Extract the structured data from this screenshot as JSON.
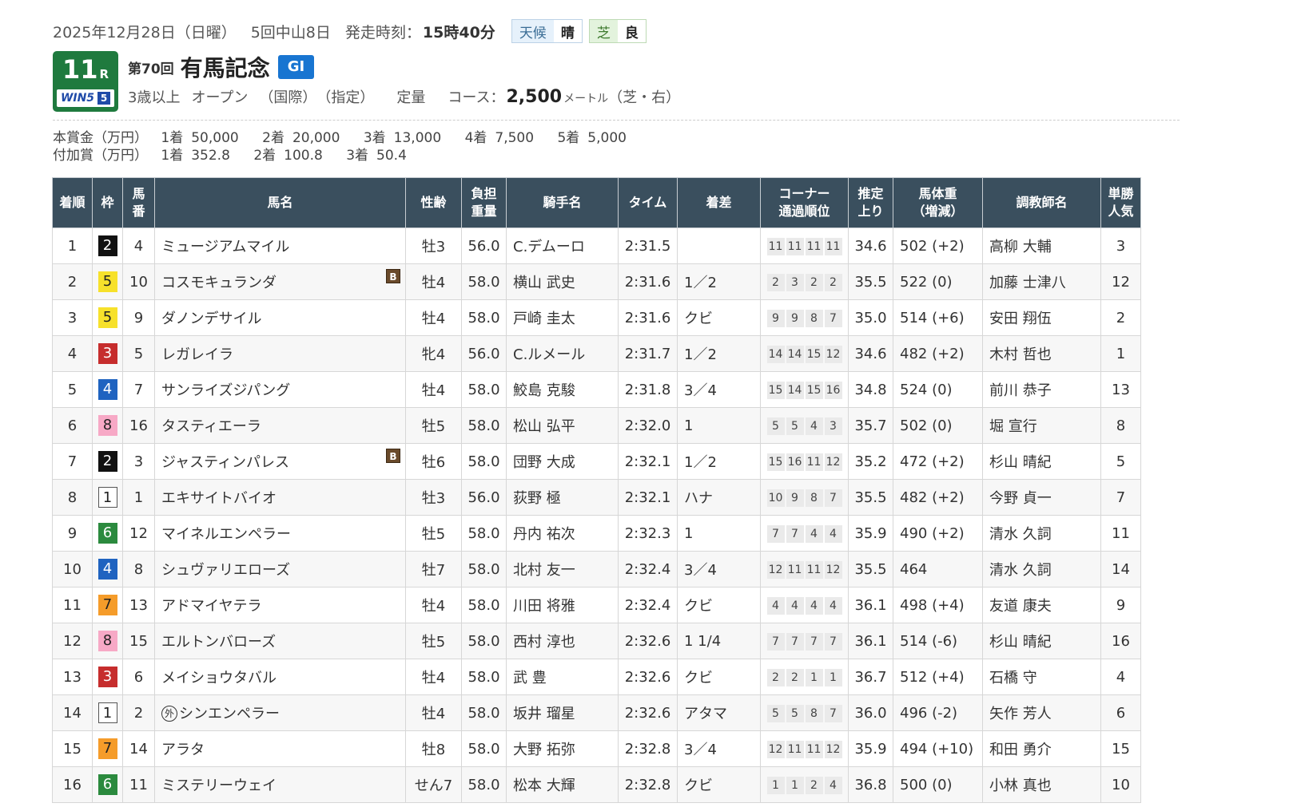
{
  "header": {
    "date_line": "2025年12月28日（日曜）",
    "meeting": "5回中山8日",
    "post_label": "発走時刻：",
    "post_time": "15時40分",
    "weather_label": "天候",
    "weather": "晴",
    "turf_label": "芝",
    "going": "良"
  },
  "race": {
    "number": "11",
    "number_suffix": "R",
    "win5_label": "WIN5",
    "win5_number": "5",
    "kai": "第70回",
    "name": "有馬記念",
    "grade": "GI",
    "age": "3歳以上",
    "class": "オープン",
    "intl": "（国際）",
    "designated": "（指定）",
    "weight_rule": "定量",
    "course_label": "コース：",
    "distance": "2,500",
    "distance_unit": "メートル",
    "surface": "（芝・右）"
  },
  "prize": {
    "main_title": "本賞金（万円）",
    "main": [
      {
        "place": "1着",
        "amount": "50,000"
      },
      {
        "place": "2着",
        "amount": "20,000"
      },
      {
        "place": "3着",
        "amount": "13,000"
      },
      {
        "place": "4着",
        "amount": "7,500"
      },
      {
        "place": "5着",
        "amount": "5,000"
      }
    ],
    "add_title": "付加賞（万円）",
    "add": [
      {
        "place": "1着",
        "amount": "352.8"
      },
      {
        "place": "2着",
        "amount": "100.8"
      },
      {
        "place": "3着",
        "amount": "50.4"
      }
    ]
  },
  "columns": {
    "place": "着順",
    "waku": "枠",
    "umaban_1": "馬",
    "umaban_2": "番",
    "horse": "馬名",
    "sexage": "性齢",
    "weight_1": "負担",
    "weight_2": "重量",
    "jockey": "騎手名",
    "time": "タイム",
    "margin": "着差",
    "corner_1": "コーナー",
    "corner_2": "通過順位",
    "last3f_1": "推定",
    "last3f_2": "上り",
    "bw_1": "馬体重",
    "bw_2": "（増減）",
    "trainer": "調教師名",
    "pop_1": "単勝",
    "pop_2": "人気"
  },
  "rows": [
    {
      "place": "1",
      "waku": "2",
      "umaban": "4",
      "horse": "ミュージアムマイル",
      "blinker": "",
      "gai": "",
      "sexage": "牡3",
      "weight": "56.0",
      "jockey": "C.デムーロ",
      "time": "2:31.5",
      "margin": "",
      "corners": [
        "11",
        "11",
        "11",
        "11"
      ],
      "last3f": "34.6",
      "bw": "502 (+2)",
      "trainer": "高柳 大輔",
      "pop": "3"
    },
    {
      "place": "2",
      "waku": "5",
      "umaban": "10",
      "horse": "コスモキュランダ",
      "blinker": "B",
      "gai": "",
      "sexage": "牡4",
      "weight": "58.0",
      "jockey": "横山 武史",
      "time": "2:31.6",
      "margin": "1／2",
      "corners": [
        "2",
        "3",
        "2",
        "2"
      ],
      "last3f": "35.5",
      "bw": "522 (0)",
      "trainer": "加藤 士津八",
      "pop": "12"
    },
    {
      "place": "3",
      "waku": "5",
      "umaban": "9",
      "horse": "ダノンデサイル",
      "blinker": "",
      "gai": "",
      "sexage": "牡4",
      "weight": "58.0",
      "jockey": "戸崎 圭太",
      "time": "2:31.6",
      "margin": "クビ",
      "corners": [
        "9",
        "9",
        "8",
        "7"
      ],
      "last3f": "35.0",
      "bw": "514 (+6)",
      "trainer": "安田 翔伍",
      "pop": "2"
    },
    {
      "place": "4",
      "waku": "3",
      "umaban": "5",
      "horse": "レガレイラ",
      "blinker": "",
      "gai": "",
      "sexage": "牝4",
      "weight": "56.0",
      "jockey": "C.ルメール",
      "time": "2:31.7",
      "margin": "1／2",
      "corners": [
        "14",
        "14",
        "15",
        "12"
      ],
      "last3f": "34.6",
      "bw": "482 (+2)",
      "trainer": "木村 哲也",
      "pop": "1"
    },
    {
      "place": "5",
      "waku": "4",
      "umaban": "7",
      "horse": "サンライズジパング",
      "blinker": "",
      "gai": "",
      "sexage": "牡4",
      "weight": "58.0",
      "jockey": "鮫島 克駿",
      "time": "2:31.8",
      "margin": "3／4",
      "corners": [
        "15",
        "14",
        "15",
        "16"
      ],
      "last3f": "34.8",
      "bw": "524 (0)",
      "trainer": "前川 恭子",
      "pop": "13"
    },
    {
      "place": "6",
      "waku": "8",
      "umaban": "16",
      "horse": "タスティエーラ",
      "blinker": "",
      "gai": "",
      "sexage": "牡5",
      "weight": "58.0",
      "jockey": "松山 弘平",
      "time": "2:32.0",
      "margin": "1",
      "corners": [
        "5",
        "5",
        "4",
        "3"
      ],
      "last3f": "35.7",
      "bw": "502 (0)",
      "trainer": "堀 宣行",
      "pop": "8"
    },
    {
      "place": "7",
      "waku": "2",
      "umaban": "3",
      "horse": "ジャスティンパレス",
      "blinker": "B",
      "gai": "",
      "sexage": "牡6",
      "weight": "58.0",
      "jockey": "団野 大成",
      "time": "2:32.1",
      "margin": "1／2",
      "corners": [
        "15",
        "16",
        "11",
        "12"
      ],
      "last3f": "35.2",
      "bw": "472 (+2)",
      "trainer": "杉山 晴紀",
      "pop": "5"
    },
    {
      "place": "8",
      "waku": "1",
      "umaban": "1",
      "horse": "エキサイトバイオ",
      "blinker": "",
      "gai": "",
      "sexage": "牡3",
      "weight": "56.0",
      "jockey": "荻野 極",
      "time": "2:32.1",
      "margin": "ハナ",
      "corners": [
        "10",
        "9",
        "8",
        "7"
      ],
      "last3f": "35.5",
      "bw": "482 (+2)",
      "trainer": "今野 貞一",
      "pop": "7"
    },
    {
      "place": "9",
      "waku": "6",
      "umaban": "12",
      "horse": "マイネルエンペラー",
      "blinker": "",
      "gai": "",
      "sexage": "牡5",
      "weight": "58.0",
      "jockey": "丹内 祐次",
      "time": "2:32.3",
      "margin": "1",
      "corners": [
        "7",
        "7",
        "4",
        "4"
      ],
      "last3f": "35.9",
      "bw": "490 (+2)",
      "trainer": "清水 久詞",
      "pop": "11"
    },
    {
      "place": "10",
      "waku": "4",
      "umaban": "8",
      "horse": "シュヴァリエローズ",
      "blinker": "",
      "gai": "",
      "sexage": "牡7",
      "weight": "58.0",
      "jockey": "北村 友一",
      "time": "2:32.4",
      "margin": "3／4",
      "corners": [
        "12",
        "11",
        "11",
        "12"
      ],
      "last3f": "35.5",
      "bw": "464",
      "trainer": "清水 久詞",
      "pop": "14"
    },
    {
      "place": "11",
      "waku": "7",
      "umaban": "13",
      "horse": "アドマイヤテラ",
      "blinker": "",
      "gai": "",
      "sexage": "牡4",
      "weight": "58.0",
      "jockey": "川田 将雅",
      "time": "2:32.4",
      "margin": "クビ",
      "corners": [
        "4",
        "4",
        "4",
        "4"
      ],
      "last3f": "36.1",
      "bw": "498 (+4)",
      "trainer": "友道 康夫",
      "pop": "9"
    },
    {
      "place": "12",
      "waku": "8",
      "umaban": "15",
      "horse": "エルトンバローズ",
      "blinker": "",
      "gai": "",
      "sexage": "牡5",
      "weight": "58.0",
      "jockey": "西村 淳也",
      "time": "2:32.6",
      "margin": "1 1/4",
      "corners": [
        "7",
        "7",
        "7",
        "7"
      ],
      "last3f": "36.1",
      "bw": "514 (-6)",
      "trainer": "杉山 晴紀",
      "pop": "16"
    },
    {
      "place": "13",
      "waku": "3",
      "umaban": "6",
      "horse": "メイショウタバル",
      "blinker": "",
      "gai": "",
      "sexage": "牡4",
      "weight": "58.0",
      "jockey": "武 豊",
      "time": "2:32.6",
      "margin": "クビ",
      "corners": [
        "2",
        "2",
        "1",
        "1"
      ],
      "last3f": "36.7",
      "bw": "512 (+4)",
      "trainer": "石橋 守",
      "pop": "4"
    },
    {
      "place": "14",
      "waku": "1",
      "umaban": "2",
      "horse": "シンエンペラー",
      "blinker": "",
      "gai": "外",
      "sexage": "牡4",
      "weight": "58.0",
      "jockey": "坂井 瑠星",
      "time": "2:32.6",
      "margin": "アタマ",
      "corners": [
        "5",
        "5",
        "8",
        "7"
      ],
      "last3f": "36.0",
      "bw": "496 (-2)",
      "trainer": "矢作 芳人",
      "pop": "6"
    },
    {
      "place": "15",
      "waku": "7",
      "umaban": "14",
      "horse": "アラタ",
      "blinker": "",
      "gai": "",
      "sexage": "牡8",
      "weight": "58.0",
      "jockey": "大野 拓弥",
      "time": "2:32.8",
      "margin": "3／4",
      "corners": [
        "12",
        "11",
        "11",
        "12"
      ],
      "last3f": "35.9",
      "bw": "494 (+10)",
      "trainer": "和田 勇介",
      "pop": "15"
    },
    {
      "place": "16",
      "waku": "6",
      "umaban": "11",
      "horse": "ミステリーウェイ",
      "blinker": "",
      "gai": "",
      "sexage": "せん7",
      "weight": "58.0",
      "jockey": "松本 大輝",
      "time": "2:32.8",
      "margin": "クビ",
      "corners": [
        "1",
        "1",
        "2",
        "4"
      ],
      "last3f": "36.8",
      "bw": "500 (0)",
      "trainer": "小林 真也",
      "pop": "10"
    }
  ]
}
